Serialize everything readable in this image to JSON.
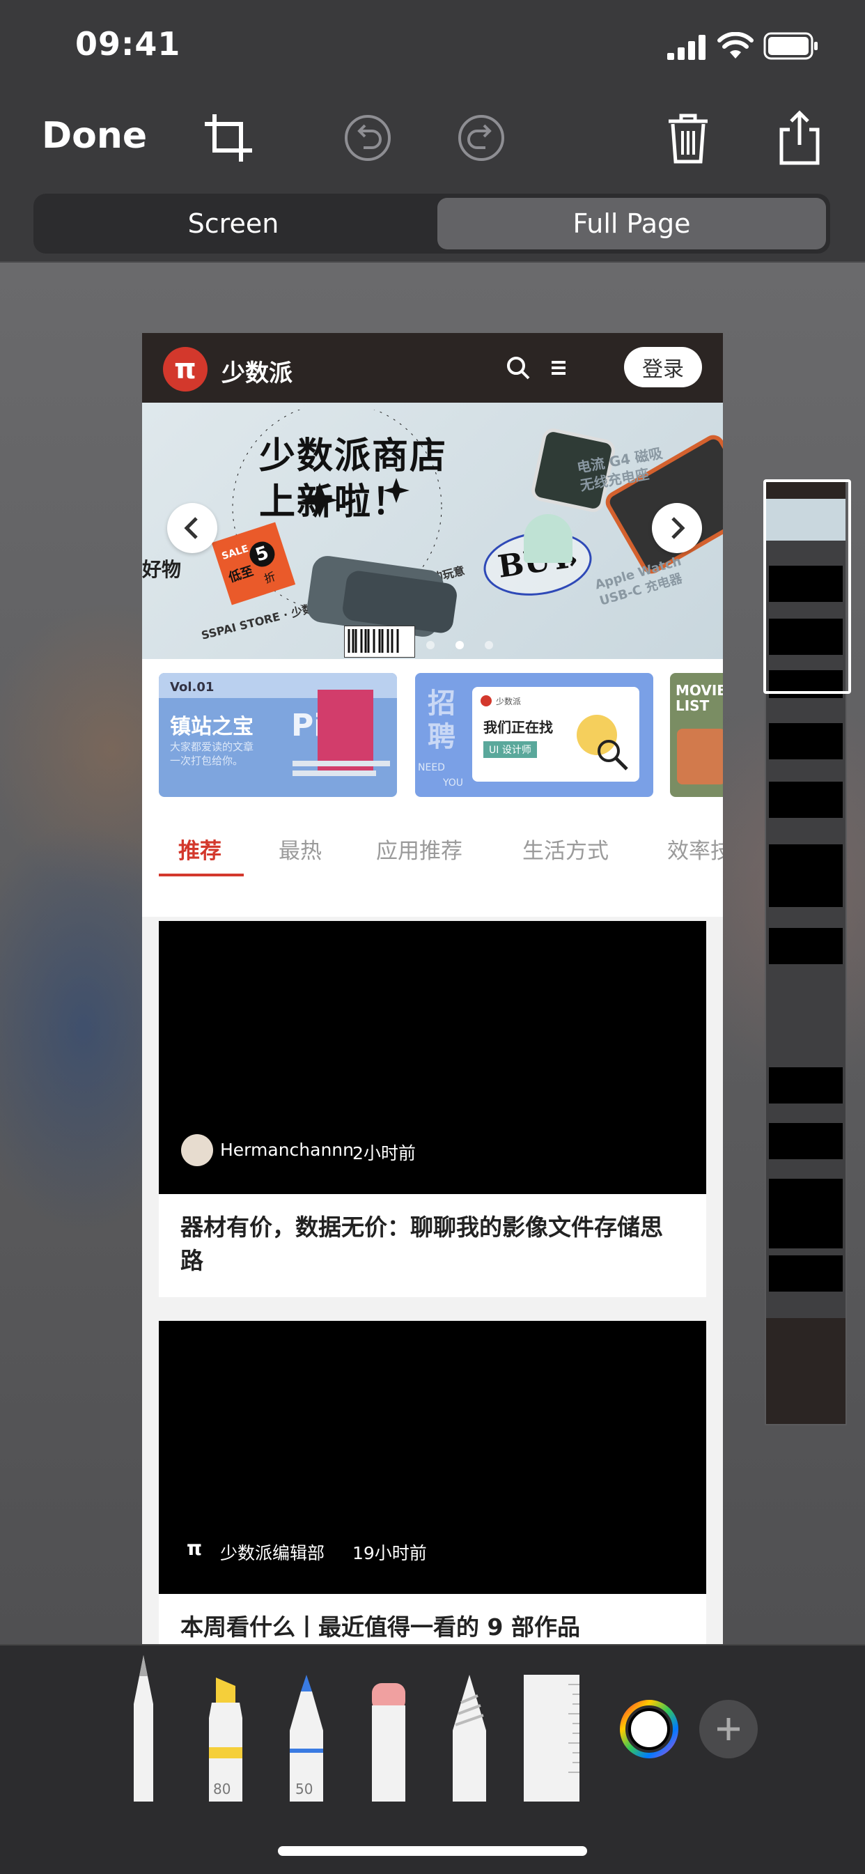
{
  "status_bar": {
    "time": "09:41"
  },
  "toolbar": {
    "done_label": "Done",
    "icons": [
      "crop-icon",
      "undo-icon",
      "redo-icon",
      "trash-icon",
      "share-icon"
    ]
  },
  "segment": {
    "screen_label": "Screen",
    "full_page_label": "Full Page",
    "selected": "Full Page"
  },
  "site": {
    "logo_glyph": "π",
    "name": "少数派",
    "login_label": "登录",
    "banner": {
      "headline_line1": "少数派商店",
      "headline_line2": "上新啦！",
      "badge_sale": "SALE",
      "badge_low": "低至",
      "badge_num": "5",
      "badge_unit": "折",
      "buy_label": "BUY",
      "product_label_1": "电流 G4 磁吸\n无线充电座",
      "product_label_2": "Apple Watch\nUSB-C 充电器",
      "ring_text": "SSPAI STORE · 少数派商店为你准备了些实用的玩意",
      "left_edge_text": "好物"
    },
    "feature_cards": [
      {
        "vol": "Vol.01",
        "title": "镇站之宝",
        "subtitle": "大家都爱读的文章\n一次打包给你。",
        "accent": "Pi"
      },
      {
        "title_big": "招聘",
        "brand": "少数派",
        "headline": "我们正在找",
        "tag": "UI 设计师",
        "need": "NEED",
        "you": "YOU"
      },
      {
        "title": "MOVIE LIST"
      }
    ],
    "tabs": [
      "推荐",
      "最热",
      "应用推荐",
      "生活方式",
      "效率技"
    ],
    "active_tab": "推荐",
    "articles": [
      {
        "author": "Hermanchannn",
        "time": "2小时前",
        "title": "器材有价，数据无价：聊聊我的影像文件存储思路"
      },
      {
        "author": "少数派编辑部",
        "time": "19小时前",
        "title": "本周看什么丨最近值得一看的 9 部作品"
      }
    ]
  },
  "markup_tools": {
    "items": [
      "pen",
      "highlighter",
      "pencil",
      "eraser",
      "lasso",
      "ruler"
    ],
    "highlighter_value": "80",
    "pencil_value": "50"
  },
  "colors": {
    "accent_red": "#d3382c",
    "toolbar_bg": "#3a3a3c",
    "segment_selected": "#636366"
  }
}
